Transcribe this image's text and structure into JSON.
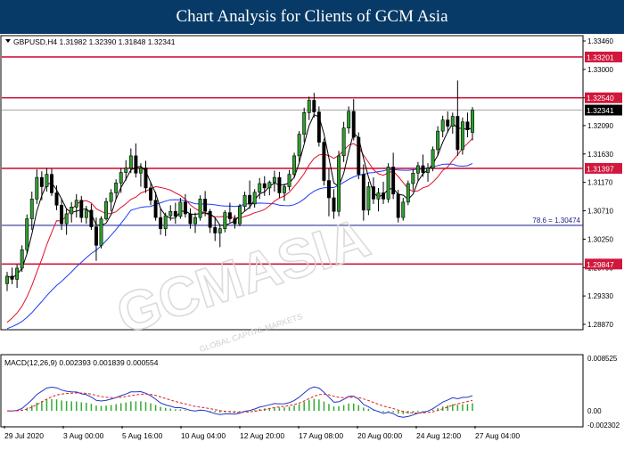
{
  "banner": {
    "title": "Chart Analysis for Clients of GCM Asia"
  },
  "colors": {
    "banner_bg": "#073a66",
    "level_line": "#d0183c",
    "fib_line": "#1a1a8c",
    "ma_red": "#e0102a",
    "ma_blue": "#1a3cff",
    "ma_black": "#000000",
    "candle_green": "#2f9e2f",
    "macd_line": "#2233cc",
    "signal_line": "#e02020",
    "histogram": "#33aa33"
  },
  "watermark": {
    "text": "GCMASIA",
    "tagline": "GLOBAL CAPITAL MARKETS"
  },
  "chart_data": [
    {
      "type": "candlestick",
      "panel": "price",
      "symbol_header": "GBPUSD,H4  1.31982 1.32390 1.31848 1.32341",
      "symbol_icon": "triangle-down-icon",
      "ylim": [
        1.2887,
        1.3346
      ],
      "y_ticks": [
        "1.33460",
        "1.33000",
        "1.32540",
        "1.32090",
        "1.31630",
        "1.31170",
        "1.30710",
        "1.30250",
        "1.29790",
        "1.29330",
        "1.28870"
      ],
      "x_ticks": [
        "29 Jul 2020",
        "3 Aug 00:00",
        "5 Aug 16:00",
        "10 Aug 04:00",
        "12 Aug 20:00",
        "17 Aug 08:00",
        "20 Aug 00:00",
        "24 Aug 12:00",
        "27 Aug 04:00"
      ],
      "levels": [
        {
          "value": 1.33201,
          "label": "1.33201",
          "style": "resistance"
        },
        {
          "value": 1.3254,
          "label": "1.32540",
          "style": "resistance"
        },
        {
          "value": 1.31397,
          "label": "1.31397",
          "style": "support"
        },
        {
          "value": 1.29847,
          "label": "1.29847",
          "style": "support"
        }
      ],
      "fib_level": {
        "value": 1.30474,
        "ratio_text": "78.6",
        "value_text": "1.30474",
        "label_text": "78.6  = 1.30474"
      },
      "current_price": {
        "value": 1.32341,
        "label": "1.32341"
      },
      "candles_ohlc": [
        [
          1.2953,
          1.2972,
          1.2941,
          1.2965
        ],
        [
          1.2965,
          1.2979,
          1.2952,
          1.296
        ],
        [
          1.296,
          1.2984,
          1.2946,
          1.2978
        ],
        [
          1.2978,
          1.3015,
          1.2972,
          1.3008
        ],
        [
          1.3008,
          1.3065,
          1.3002,
          1.3058
        ],
        [
          1.3058,
          1.3102,
          1.304,
          1.309
        ],
        [
          1.309,
          1.3138,
          1.3082,
          1.3125
        ],
        [
          1.3125,
          1.3135,
          1.3088,
          1.311
        ],
        [
          1.311,
          1.314,
          1.3102,
          1.313
        ],
        [
          1.313,
          1.3139,
          1.3095,
          1.31
        ],
        [
          1.31,
          1.3112,
          1.3072,
          1.308
        ],
        [
          1.308,
          1.309,
          1.304,
          1.305
        ],
        [
          1.305,
          1.3074,
          1.3032,
          1.3066
        ],
        [
          1.3066,
          1.3085,
          1.3052,
          1.3077
        ],
        [
          1.3077,
          1.3098,
          1.306,
          1.3088
        ],
        [
          1.3088,
          1.3095,
          1.3052,
          1.306
        ],
        [
          1.306,
          1.3079,
          1.305,
          1.3072
        ],
        [
          1.3072,
          1.3082,
          1.304,
          1.3045
        ],
        [
          1.3045,
          1.306,
          1.299,
          1.3015
        ],
        [
          1.3015,
          1.3062,
          1.301,
          1.3058
        ],
        [
          1.3058,
          1.3092,
          1.3055,
          1.3086
        ],
        [
          1.3086,
          1.3106,
          1.307,
          1.31
        ],
        [
          1.31,
          1.3122,
          1.309,
          1.3116
        ],
        [
          1.3116,
          1.314,
          1.31,
          1.3133
        ],
        [
          1.3133,
          1.3153,
          1.312,
          1.314
        ],
        [
          1.314,
          1.3172,
          1.3132,
          1.316
        ],
        [
          1.316,
          1.318,
          1.3125,
          1.3132
        ],
        [
          1.3132,
          1.3148,
          1.311,
          1.314
        ],
        [
          1.314,
          1.3152,
          1.31,
          1.3108
        ],
        [
          1.3108,
          1.3118,
          1.308,
          1.3088
        ],
        [
          1.3088,
          1.3102,
          1.3055,
          1.306
        ],
        [
          1.306,
          1.3076,
          1.3032,
          1.3042
        ],
        [
          1.3042,
          1.3068,
          1.303,
          1.3063
        ],
        [
          1.3063,
          1.308,
          1.3055,
          1.307
        ],
        [
          1.307,
          1.3084,
          1.305,
          1.3062
        ],
        [
          1.3062,
          1.3092,
          1.3058,
          1.3085
        ],
        [
          1.3085,
          1.3098,
          1.306,
          1.3066
        ],
        [
          1.3066,
          1.3075,
          1.3042,
          1.305
        ],
        [
          1.305,
          1.3068,
          1.3035,
          1.306
        ],
        [
          1.306,
          1.3096,
          1.3055,
          1.309
        ],
        [
          1.309,
          1.3103,
          1.3062,
          1.307
        ],
        [
          1.307,
          1.3074,
          1.3035,
          1.3044
        ],
        [
          1.3044,
          1.306,
          1.3022,
          1.3035
        ],
        [
          1.3035,
          1.3048,
          1.3012,
          1.3042
        ],
        [
          1.3042,
          1.3072,
          1.3036,
          1.3068
        ],
        [
          1.3068,
          1.3084,
          1.3052,
          1.3058
        ],
        [
          1.3058,
          1.3064,
          1.3042,
          1.305
        ],
        [
          1.305,
          1.3082,
          1.3046,
          1.3078
        ],
        [
          1.3078,
          1.3102,
          1.307,
          1.3096
        ],
        [
          1.3096,
          1.312,
          1.3074,
          1.3082
        ],
        [
          1.3082,
          1.3106,
          1.3076,
          1.3101
        ],
        [
          1.3101,
          1.3124,
          1.309,
          1.3115
        ],
        [
          1.3115,
          1.3127,
          1.3095,
          1.3108
        ],
        [
          1.3108,
          1.312,
          1.3096,
          1.3117
        ],
        [
          1.3117,
          1.3136,
          1.3102,
          1.3125
        ],
        [
          1.3125,
          1.3134,
          1.3092,
          1.31
        ],
        [
          1.31,
          1.3115,
          1.3087,
          1.311
        ],
        [
          1.311,
          1.3137,
          1.3104,
          1.313
        ],
        [
          1.313,
          1.3165,
          1.3125,
          1.316
        ],
        [
          1.316,
          1.32,
          1.315,
          1.3195
        ],
        [
          1.3195,
          1.3238,
          1.3182,
          1.323
        ],
        [
          1.323,
          1.3256,
          1.3218,
          1.325
        ],
        [
          1.325,
          1.3262,
          1.3222,
          1.3231
        ],
        [
          1.3231,
          1.324,
          1.3175,
          1.3182
        ],
        [
          1.3182,
          1.3188,
          1.3112,
          1.312
        ],
        [
          1.312,
          1.314,
          1.3062,
          1.3092
        ],
        [
          1.3092,
          1.3106,
          1.3058,
          1.307
        ],
        [
          1.307,
          1.3168,
          1.3062,
          1.316
        ],
        [
          1.316,
          1.3215,
          1.315,
          1.3205
        ],
        [
          1.3205,
          1.324,
          1.3196,
          1.3232
        ],
        [
          1.3232,
          1.3252,
          1.3185,
          1.319
        ],
        [
          1.319,
          1.3198,
          1.3122,
          1.313
        ],
        [
          1.313,
          1.3146,
          1.3055,
          1.3072
        ],
        [
          1.3072,
          1.3118,
          1.3064,
          1.311
        ],
        [
          1.311,
          1.3125,
          1.3082,
          1.309
        ],
        [
          1.309,
          1.3108,
          1.307,
          1.31
        ],
        [
          1.31,
          1.3118,
          1.3082,
          1.309
        ],
        [
          1.309,
          1.3148,
          1.3084,
          1.3142
        ],
        [
          1.3142,
          1.3165,
          1.309,
          1.3098
        ],
        [
          1.3098,
          1.3105,
          1.3052,
          1.306
        ],
        [
          1.306,
          1.3092,
          1.3055,
          1.3085
        ],
        [
          1.3085,
          1.312,
          1.308,
          1.3115
        ],
        [
          1.3115,
          1.3138,
          1.3104,
          1.3132
        ],
        [
          1.3132,
          1.315,
          1.312,
          1.3144
        ],
        [
          1.3144,
          1.3162,
          1.3126,
          1.3133
        ],
        [
          1.3133,
          1.3148,
          1.3118,
          1.314
        ],
        [
          1.314,
          1.3175,
          1.3135,
          1.317
        ],
        [
          1.317,
          1.3208,
          1.316,
          1.32
        ],
        [
          1.32,
          1.3225,
          1.319,
          1.3218
        ],
        [
          1.3218,
          1.3232,
          1.3198,
          1.3208
        ],
        [
          1.3208,
          1.323,
          1.3196,
          1.3224
        ],
        [
          1.3224,
          1.3282,
          1.316,
          1.317
        ],
        [
          1.317,
          1.3222,
          1.3162,
          1.3215
        ],
        [
          1.3215,
          1.323,
          1.319,
          1.3202
        ],
        [
          1.3198,
          1.3239,
          1.3185,
          1.3234
        ]
      ]
    },
    {
      "type": "line",
      "panel": "indicator",
      "label": "MACD(12,26,9) 0.002393 0.001839 0.000554",
      "ylim": [
        -0.0023,
        0.00852
      ],
      "y_ticks": [
        "0.008525",
        "0.00",
        "-0.002302"
      ]
    }
  ]
}
